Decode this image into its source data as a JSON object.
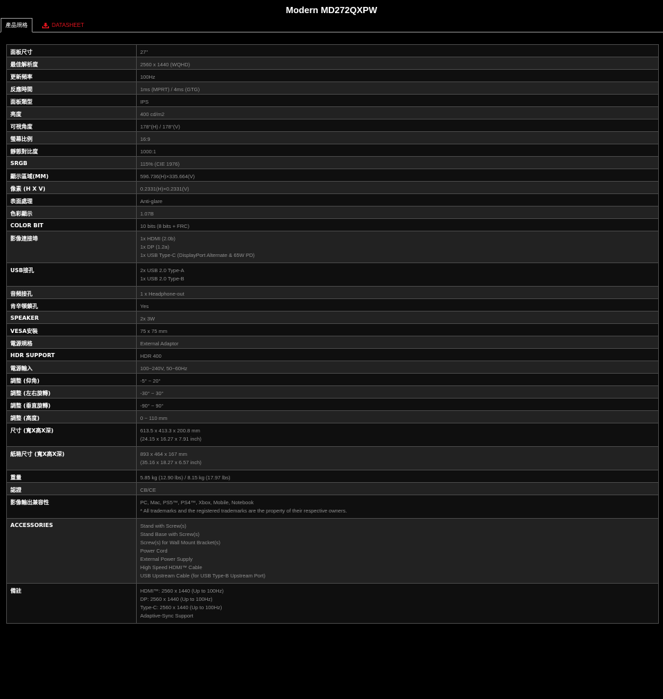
{
  "title": "Modern MD272QXPW",
  "tabs": {
    "spec_label": "產品規格",
    "datasheet_label": "DATASHEET",
    "datasheet_icon": "download-icon",
    "datasheet_color": "#e0141e"
  },
  "specs": [
    {
      "label": "面板尺寸",
      "lines": [
        "27\""
      ]
    },
    {
      "label": "最佳解析度",
      "lines": [
        "2560 x 1440 (WQHD)"
      ]
    },
    {
      "label": "更新頻率",
      "lines": [
        "100Hz"
      ]
    },
    {
      "label": "反應時間",
      "lines": [
        "1ms (MPRT) / 4ms (GTG)"
      ]
    },
    {
      "label": "面板類型",
      "lines": [
        "IPS"
      ]
    },
    {
      "label": "亮度",
      "lines": [
        "400 cd/m2"
      ]
    },
    {
      "label": "可視角度",
      "lines": [
        "178°(H) / 178°(V)"
      ]
    },
    {
      "label": "螢幕比例",
      "lines": [
        "16:9"
      ]
    },
    {
      "label": "靜態對比度",
      "lines": [
        "1000:1"
      ]
    },
    {
      "label": "SRGB",
      "lines": [
        "115% (CIE 1976)"
      ]
    },
    {
      "label": "顯示區域(MM)",
      "lines": [
        "596.736(H)×335.664(V)"
      ]
    },
    {
      "label": "像素 (H X V)",
      "lines": [
        "0.2331(H)×0.2331(V)"
      ]
    },
    {
      "label": "表面處理",
      "lines": [
        "Anti-glare"
      ]
    },
    {
      "label": "色彩顯示",
      "lines": [
        "1.07B"
      ]
    },
    {
      "label": "COLOR BIT",
      "lines": [
        "10 bits (8 bits + FRC)"
      ]
    },
    {
      "label": "影像連接埠",
      "lines": [
        "1x HDMI (2.0b)",
        "1x DP (1.2a)",
        "1x USB Type-C (DisplayPort Alternate & 65W PD)"
      ]
    },
    {
      "label": "USB接孔",
      "lines": [
        "2x USB 2.0 Type-A",
        "1x USB 2.0 Type-B"
      ]
    },
    {
      "label": "音頻接孔",
      "lines": [
        "1 x Headphone-out"
      ]
    },
    {
      "label": "肯辛頓鎖孔",
      "lines": [
        "Yes"
      ]
    },
    {
      "label": "SPEAKER",
      "lines": [
        "2x 3W"
      ]
    },
    {
      "label": "VESA安裝",
      "lines": [
        "75 x 75 mm"
      ]
    },
    {
      "label": "電源規格",
      "lines": [
        "External Adaptor"
      ]
    },
    {
      "label": "HDR SUPPORT",
      "lines": [
        "HDR 400"
      ]
    },
    {
      "label": "電源輸入",
      "lines": [
        "100~240V, 50~60Hz"
      ]
    },
    {
      "label": "調整 (仰角)",
      "lines": [
        "-5° ~ 20°"
      ]
    },
    {
      "label": "調整 (左右旋轉)",
      "lines": [
        "-30° ~ 30°"
      ]
    },
    {
      "label": "調整 (垂直旋轉)",
      "lines": [
        "-90° ~ 90°"
      ]
    },
    {
      "label": "調整 (高度)",
      "lines": [
        "0 ~ 110 mm"
      ]
    },
    {
      "label": "尺寸 (寬X高X深)",
      "lines": [
        "613.5 x 413.3 x 200.8 mm",
        "(24.15 x 16.27 x 7.91 inch)"
      ]
    },
    {
      "label": "紙箱尺寸 (寬X高X深)",
      "lines": [
        "893 x 464 x 167 mm",
        "(35.16 x 18.27 x 6.57 inch)"
      ]
    },
    {
      "label": "重量",
      "lines": [
        "5.85 kg (12.90 lbs) / 8.15 kg (17.97 lbs)"
      ]
    },
    {
      "label": "認證",
      "lines": [
        "CB/CE"
      ]
    },
    {
      "label": "影像輸出兼容性",
      "lines": [
        "PC, Mac, PS5™, PS4™, Xbox, Mobile, Notebook",
        "* All trademarks and the registered trademarks are the property of their respective owners."
      ]
    },
    {
      "label": "ACCESSORIES",
      "lines": [
        "Stand with Screw(s)",
        "Stand Base with Screw(s)",
        "Screw(s) for Wall Mount Bracket(s)",
        "Power Cord",
        "External Power Supply",
        "High Speed HDMI™ Cable",
        "USB Upstream Cable (for USB Type-B Upstream Port)"
      ]
    },
    {
      "label": "備註",
      "lines": [
        "HDMI™: 2560 x 1440 (Up to 100Hz)",
        "DP: 2560 x 1440 (Up to 100Hz)",
        "Type-C: 2560 x 1440 (Up to 100Hz)",
        "Adaptive-Sync Support"
      ]
    }
  ]
}
